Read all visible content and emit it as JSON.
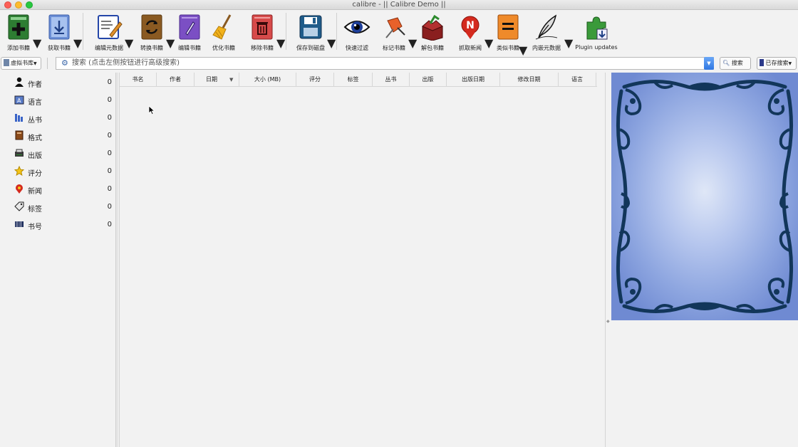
{
  "window": {
    "title": "calibre - || Calibre Demo ||"
  },
  "toolbar": {
    "add_books": "添加书籍",
    "get_books": "获取书籍",
    "edit_metadata": "编辑元数据",
    "convert_books": "转换书籍",
    "edit_book": "编辑书籍",
    "polish_books": "优化书籍",
    "remove_books": "移除书籍",
    "save_to_disk": "保存到磁盘",
    "quick_view": "快速过滤",
    "mark_books": "标记书籍",
    "unpack_book": "解包书籍",
    "fetch_news": "抓取新闻",
    "similar_books": "类似书籍",
    "embed_metadata": "内嵌元数据",
    "plugin_updates": "Plugin updates"
  },
  "search": {
    "virtual_library": "虚拟书库",
    "placeholder": "搜索 (点击左侧按钮进行高级搜索)",
    "search_button": "搜索",
    "saved_searches": "已存搜索"
  },
  "tag_browser": {
    "items": [
      {
        "label": "作者",
        "count": "0",
        "icon": "person-icon"
      },
      {
        "label": "语言",
        "count": "0",
        "icon": "language-icon"
      },
      {
        "label": "丛书",
        "count": "0",
        "icon": "series-icon"
      },
      {
        "label": "格式",
        "count": "0",
        "icon": "format-icon"
      },
      {
        "label": "出版",
        "count": "0",
        "icon": "publisher-icon"
      },
      {
        "label": "评分",
        "count": "0",
        "icon": "star-icon"
      },
      {
        "label": "新闻",
        "count": "0",
        "icon": "news-icon"
      },
      {
        "label": "标签",
        "count": "0",
        "icon": "tag-icon"
      },
      {
        "label": "书号",
        "count": "0",
        "icon": "identifier-icon"
      }
    ]
  },
  "book_list": {
    "columns": [
      "书名",
      "作者",
      "日期",
      "大小 (MB)",
      "评分",
      "标签",
      "丛书",
      "出版",
      "出版日期",
      "修改日期",
      "语言"
    ],
    "sorted_column": "日期"
  },
  "colors": {
    "cover_light": "#c7d3ef",
    "cover_dark": "#12365a",
    "cover_mid": "#7c97dc"
  }
}
